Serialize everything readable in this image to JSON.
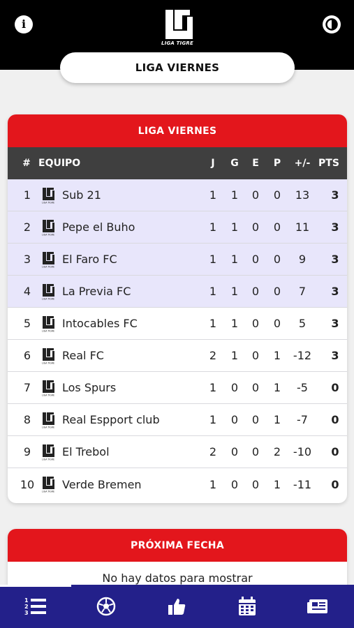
{
  "header": {
    "logo_text": "LIGA TIGRE",
    "info_icon": "info-icon",
    "theme_icon": "contrast-icon"
  },
  "league_selector": {
    "label": "LIGA VIERNES"
  },
  "standings": {
    "title": "LIGA VIERNES",
    "columns": {
      "pos": "#",
      "team": "EQUIPO",
      "played": "J",
      "won": "G",
      "drawn": "E",
      "lost": "P",
      "diff": "+/-",
      "points": "PTS"
    },
    "team_badge_text": "LIGA TIGRE",
    "rows": [
      {
        "pos": "1",
        "team": "Sub 21",
        "j": "1",
        "g": "1",
        "e": "0",
        "p": "0",
        "diff": "13",
        "pts": "3"
      },
      {
        "pos": "2",
        "team": "Pepe el Buho",
        "j": "1",
        "g": "1",
        "e": "0",
        "p": "0",
        "diff": "11",
        "pts": "3"
      },
      {
        "pos": "3",
        "team": "El Faro FC",
        "j": "1",
        "g": "1",
        "e": "0",
        "p": "0",
        "diff": "9",
        "pts": "3"
      },
      {
        "pos": "4",
        "team": "La Previa FC",
        "j": "1",
        "g": "1",
        "e": "0",
        "p": "0",
        "diff": "7",
        "pts": "3"
      },
      {
        "pos": "5",
        "team": "Intocables FC",
        "j": "1",
        "g": "1",
        "e": "0",
        "p": "0",
        "diff": "5",
        "pts": "3"
      },
      {
        "pos": "6",
        "team": "Real FC",
        "j": "2",
        "g": "1",
        "e": "0",
        "p": "1",
        "diff": "-12",
        "pts": "3"
      },
      {
        "pos": "7",
        "team": "Los Spurs",
        "j": "1",
        "g": "0",
        "e": "0",
        "p": "1",
        "diff": "-5",
        "pts": "0"
      },
      {
        "pos": "8",
        "team": "Real Espport club",
        "j": "1",
        "g": "0",
        "e": "0",
        "p": "1",
        "diff": "-7",
        "pts": "0"
      },
      {
        "pos": "9",
        "team": "El Trebol",
        "j": "2",
        "g": "0",
        "e": "0",
        "p": "2",
        "diff": "-10",
        "pts": "0"
      },
      {
        "pos": "10",
        "team": "Verde Bremen",
        "j": "1",
        "g": "0",
        "e": "0",
        "p": "1",
        "diff": "-11",
        "pts": "0"
      }
    ]
  },
  "next_match": {
    "title": "PRÓXIMA FECHA",
    "empty_message": "No hay datos para mostrar"
  },
  "bottom_nav": {
    "items": [
      "standings-icon",
      "ball-icon",
      "thumbs-up-icon",
      "calendar-icon",
      "news-icon"
    ],
    "active_index": 0
  },
  "colors": {
    "accent_red": "#e3161c",
    "nav_blue": "#23208a",
    "header_black": "#000000",
    "highlight_row": "#e8e6fb",
    "table_head": "#3f3f3f"
  }
}
